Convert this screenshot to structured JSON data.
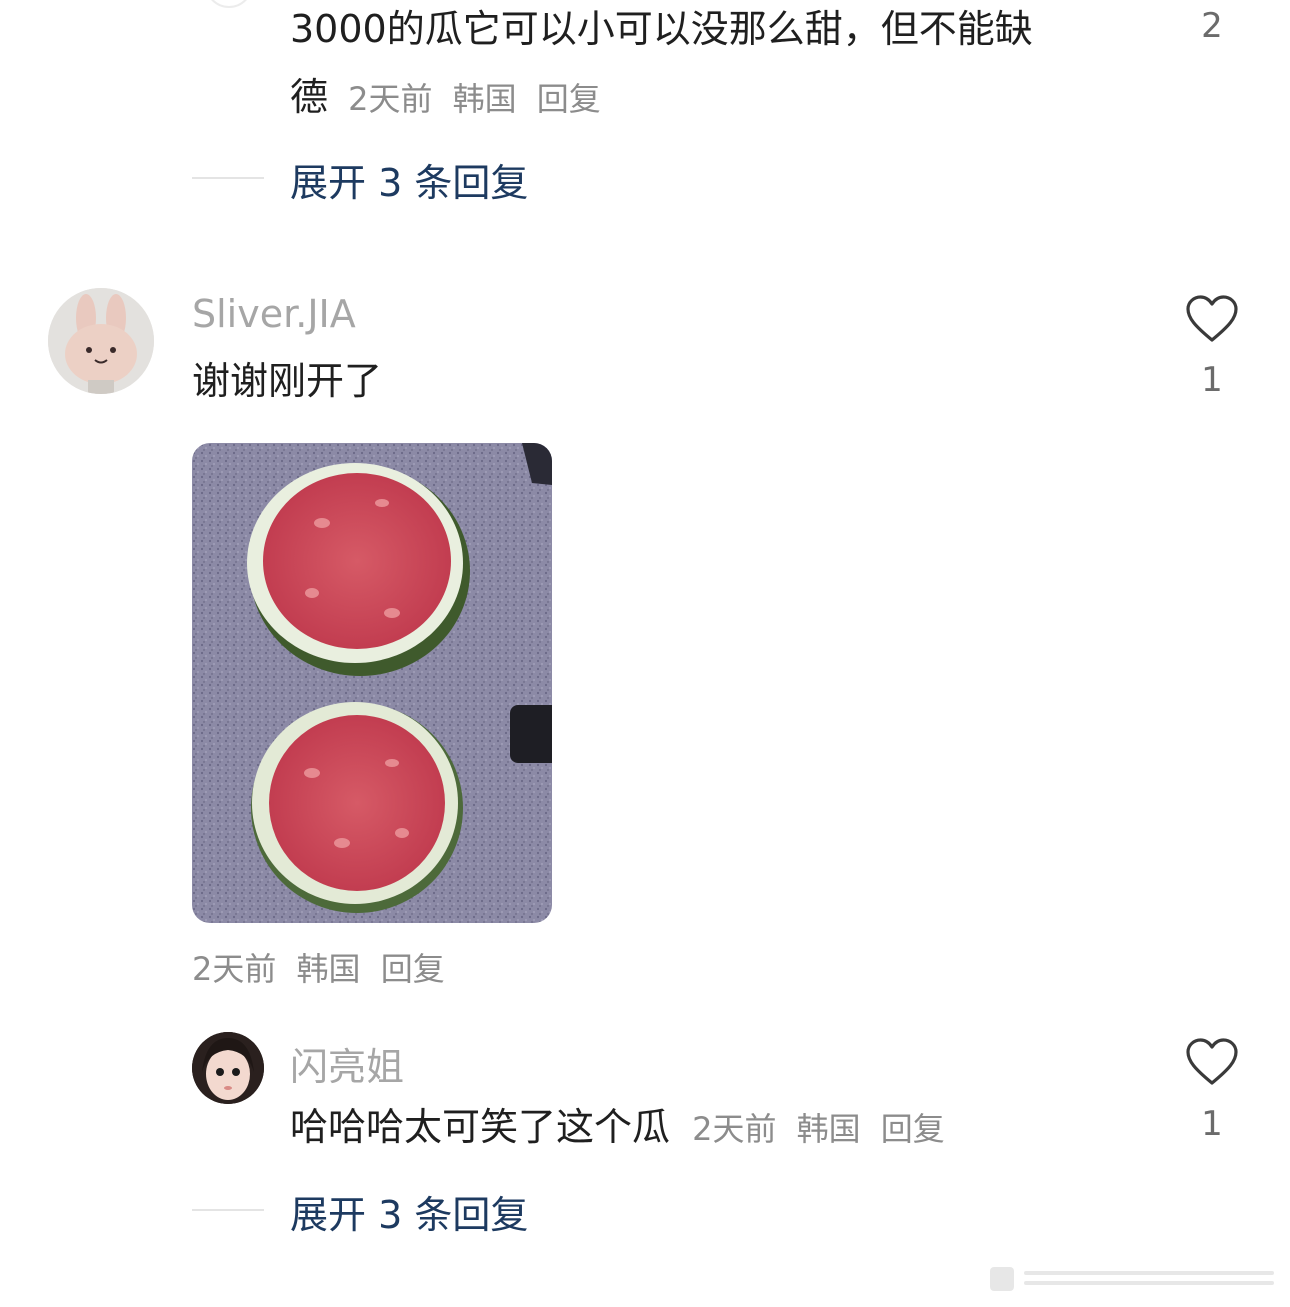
{
  "comments": [
    {
      "text_line1": "3000的瓜它可以小可以没那么甜，但不能缺",
      "text_line2": "德",
      "time": "2天前",
      "location": "韩国",
      "reply_label": "回复",
      "likes": "2",
      "expand_label": "展开 3 条回复"
    },
    {
      "username": "Sliver.JIA",
      "text": "谢谢刚开了",
      "avatar_icon": "bunny-plush-avatar",
      "photo_desc": "two watermelon halves on a gray speckled countertop",
      "time": "2天前",
      "location": "韩国",
      "reply_label": "回复",
      "likes": "1"
    },
    {
      "username": "闪亮姐",
      "text": "哈哈哈太可笑了这个瓜",
      "avatar_icon": "girl-face-avatar",
      "time": "2天前",
      "location": "韩国",
      "reply_label": "回复",
      "likes": "1",
      "expand_label": "展开 3 条回复"
    }
  ],
  "colors": {
    "link": "#1d3a60",
    "meta": "#8c8c8c",
    "text": "#1f1f1f"
  }
}
